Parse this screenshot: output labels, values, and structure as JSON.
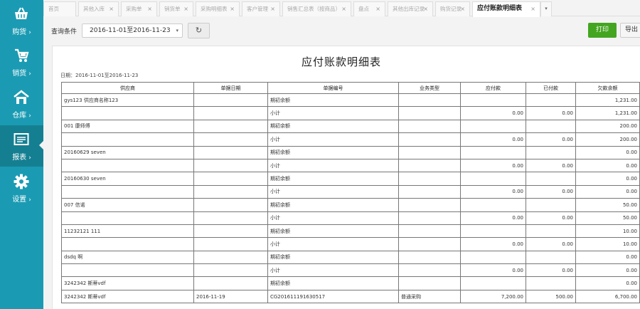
{
  "sidebar": {
    "items": [
      {
        "label": "购货",
        "icon": "basket-icon"
      },
      {
        "label": "销货",
        "icon": "cart-icon"
      },
      {
        "label": "仓库",
        "icon": "warehouse-icon"
      },
      {
        "label": "报表",
        "icon": "report-icon"
      },
      {
        "label": "设置",
        "icon": "gear-icon"
      }
    ],
    "active_index": 3,
    "arrow": "›"
  },
  "tabs": [
    {
      "label": "首页",
      "closable": false
    },
    {
      "label": "其他入库",
      "closable": true
    },
    {
      "label": "采购单",
      "closable": true
    },
    {
      "label": "销货单",
      "closable": true
    },
    {
      "label": "采购明细表",
      "closable": true
    },
    {
      "label": "客户管理",
      "closable": true
    },
    {
      "label": "销售汇总表（按商品）",
      "closable": true
    },
    {
      "label": "盘点",
      "closable": true
    },
    {
      "label": "其他出库记录",
      "closable": true
    },
    {
      "label": "购货记录",
      "closable": true
    },
    {
      "label": "应付账款明细表",
      "closable": true,
      "active": true
    }
  ],
  "tab_close": "×",
  "tab_more": "▾",
  "toolbar": {
    "query_label": "查询条件",
    "date_range": "2016-11-01至2016-11-23",
    "caret": "▾",
    "refresh_icon": "↻",
    "print_label": "打印",
    "export_label": "导出"
  },
  "report": {
    "title": "应付账款明细表",
    "date_line": "日期：2016-11-01至2016-11-23",
    "columns": [
      "供应商",
      "单据日期",
      "单据编号",
      "业务类型",
      "应付款",
      "已付款",
      "欠款余额"
    ],
    "rows": [
      [
        "gys123 供应商名称123",
        "",
        "期初余额",
        "",
        "",
        "",
        "1,231.00"
      ],
      [
        "",
        "",
        "小计",
        "",
        "0.00",
        "0.00",
        "1,231.00"
      ],
      [
        "001 康师傅",
        "",
        "期初余额",
        "",
        "",
        "",
        "200.00"
      ],
      [
        "",
        "",
        "小计",
        "",
        "0.00",
        "0.00",
        "200.00"
      ],
      [
        "20160629 seven",
        "",
        "期初余额",
        "",
        "",
        "",
        "0.00"
      ],
      [
        "",
        "",
        "小计",
        "",
        "0.00",
        "0.00",
        "0.00"
      ],
      [
        "20160630 seven",
        "",
        "期初余额",
        "",
        "",
        "",
        "0.00"
      ],
      [
        "",
        "",
        "小计",
        "",
        "0.00",
        "0.00",
        "0.00"
      ],
      [
        "007 信诺",
        "",
        "期初余额",
        "",
        "",
        "",
        "50.00"
      ],
      [
        "",
        "",
        "小计",
        "",
        "0.00",
        "0.00",
        "50.00"
      ],
      [
        "11232121 111",
        "",
        "期初余额",
        "",
        "",
        "",
        "10.00"
      ],
      [
        "",
        "",
        "小计",
        "",
        "0.00",
        "0.00",
        "10.00"
      ],
      [
        "dsdq 啊",
        "",
        "期初余额",
        "",
        "",
        "",
        "0.00"
      ],
      [
        "",
        "",
        "小计",
        "",
        "0.00",
        "0.00",
        "0.00"
      ],
      [
        "3242342 斯蒂vdf",
        "",
        "期初余额",
        "",
        "",
        "",
        "0.00"
      ],
      [
        "3242342 斯蒂vdf",
        "2016-11-19",
        "CG201611191630517",
        "普通采购",
        "7,200.00",
        "500.00",
        "6,700.00"
      ]
    ]
  },
  "colors": {
    "sidebar": "#1b9bb3",
    "sidebar_active": "#157f92",
    "print_button": "#44a521"
  }
}
